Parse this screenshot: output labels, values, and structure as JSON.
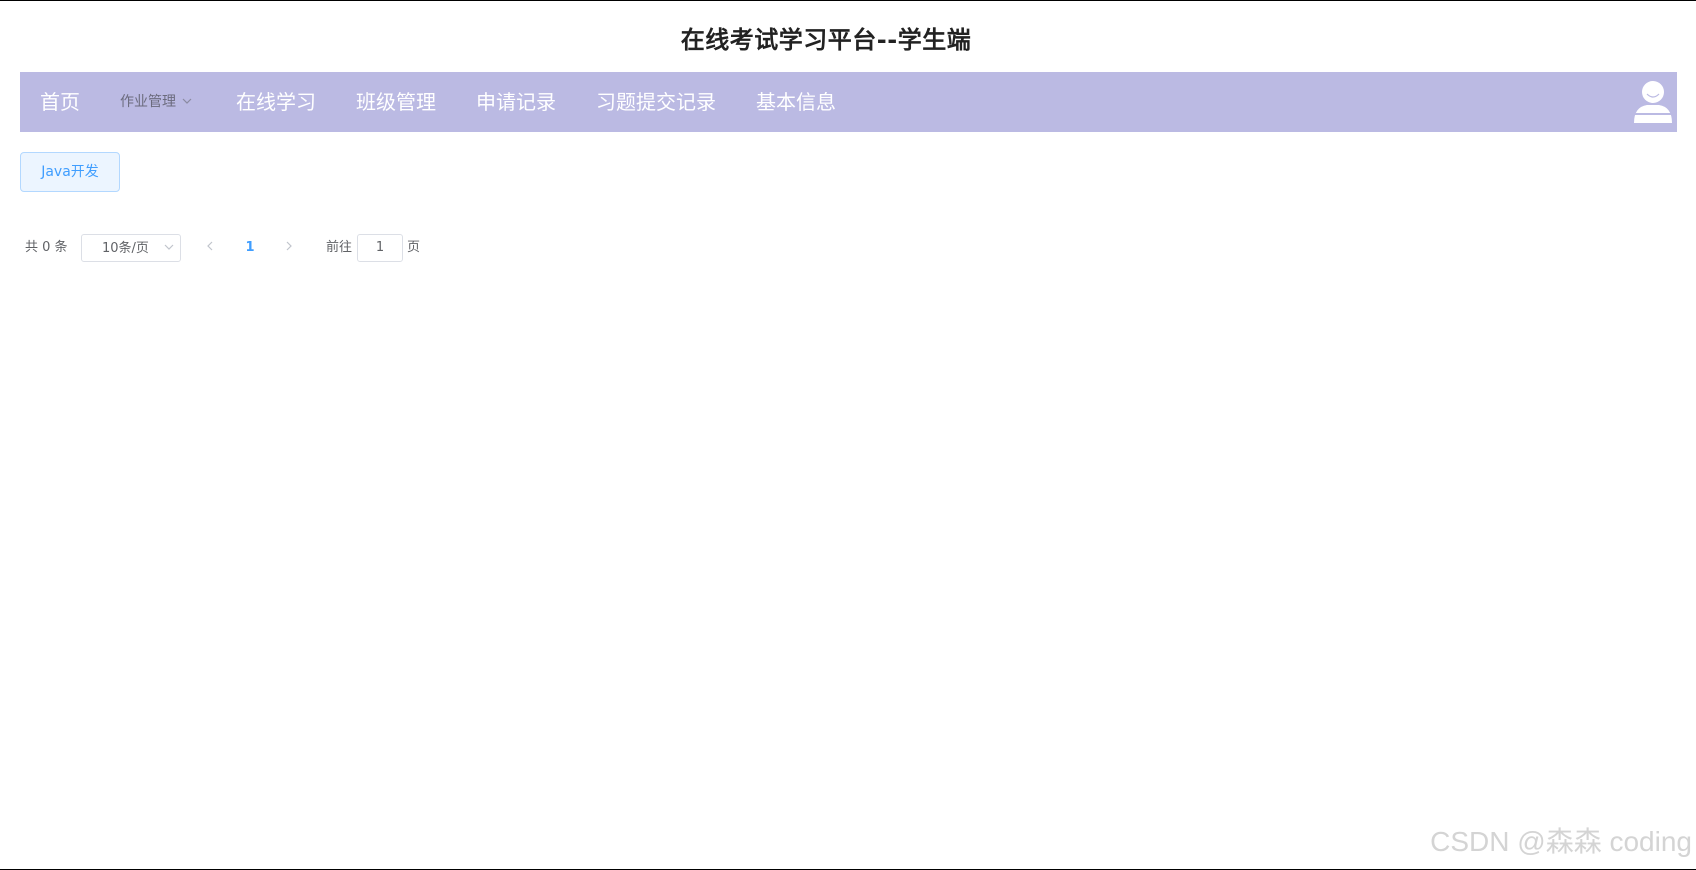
{
  "header": {
    "title": "在线考试学习平台--学生端"
  },
  "nav": {
    "items": [
      {
        "label": "首页"
      },
      {
        "label": "作业管理"
      },
      {
        "label": "在线学习"
      },
      {
        "label": "班级管理"
      },
      {
        "label": "申请记录"
      },
      {
        "label": "习题提交记录"
      },
      {
        "label": "基本信息"
      }
    ],
    "user_icon": "user-avatar-icon"
  },
  "course_tag": {
    "label": "Java开发"
  },
  "pagination": {
    "total_text": "共 0 条",
    "page_size": "10条/页",
    "current_page": "1",
    "goto_label": "前往",
    "goto_value": "1",
    "goto_suffix": "页"
  },
  "watermark": "CSDN @森森 coding",
  "colors": {
    "nav_bg": "#bbbae3",
    "accent": "#409eff",
    "tag_bg": "#ecf5ff",
    "tag_border": "#b3d8ff"
  }
}
